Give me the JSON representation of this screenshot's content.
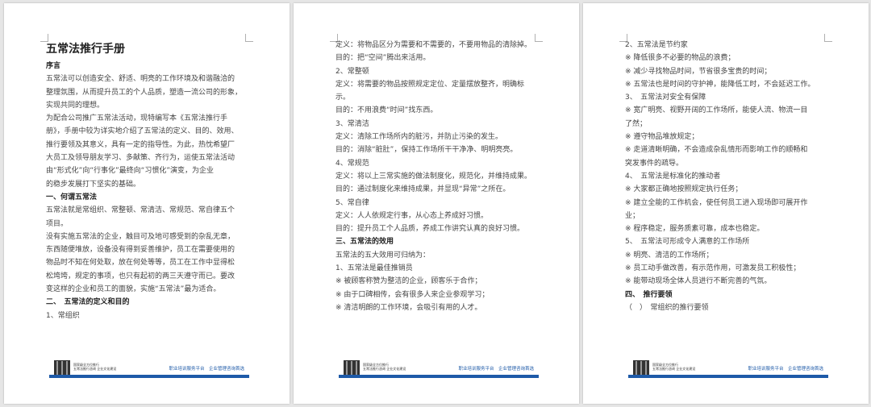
{
  "pages": [
    {
      "title": "五常法推行手册",
      "lines": [
        {
          "t": "序言",
          "s": "h"
        },
        {
          "t": "五常法可以创造安全、舒适、明亮的工作环境及和谐融洽的",
          "s": ""
        },
        {
          "t": "整理氛围，从而提升员工的个人品质，塑造一流公司的形象，",
          "s": ""
        },
        {
          "t": "实现共同的理想。",
          "s": ""
        },
        {
          "t": "为配合公司推广五常法活动，现特编写本《五常法推行手",
          "s": ""
        },
        {
          "t": "册》，手册中较为详实地介绍了五常法的定义、目的、效用、",
          "s": ""
        },
        {
          "t": "推行要领及其意义，具有一定的指导性。为此，热忱希望厂",
          "s": ""
        },
        {
          "t": "大员工及领导朋友学习、多献策、齐行为，运使五常法活动",
          "s": ""
        },
        {
          "t": "由“形式化”向“行事化”最终向“习惯化”演变，为企业",
          "s": ""
        },
        {
          "t": "的稳步发展打下坚实的基础。",
          "s": ""
        },
        {
          "t": "一、何谓五常法",
          "s": "h"
        },
        {
          "t": "五常法就是常组织、常整顿、常清洁、常规范、常自律五个",
          "s": ""
        },
        {
          "t": "项目。",
          "s": ""
        },
        {
          "t": "没有实施五常法的企业，触目可及地可感受到的杂乱无章，",
          "s": ""
        },
        {
          "t": "东西随便堆放，设备没有得到妥善维护，员工在需要使用的",
          "s": ""
        },
        {
          "t": "物品时不知在何处取，放在何处等等，员工在工作中显得松",
          "s": ""
        },
        {
          "t": "松垮垮，规定的事项，也只有起初的两三天遵守而已。要改",
          "s": ""
        },
        {
          "t": "变这样的企业和员工的面貌，实施“五常法”最为适合。",
          "s": ""
        },
        {
          "t": "二、　五常法的定义和目的",
          "s": "h"
        },
        {
          "t": "1、常组织",
          "s": ""
        }
      ]
    },
    {
      "lines": [
        {
          "t": "定义：将物品区分为需要和不需要的，不要用物品的清除掉。",
          "s": ""
        },
        {
          "t": "目的：把“空间”腾出来活用。",
          "s": ""
        },
        {
          "t": "2、常整顿",
          "s": ""
        },
        {
          "t": "定义：将需要的物品按照规定定位、定量摆放整齐，明确标",
          "s": ""
        },
        {
          "t": "示。",
          "s": ""
        },
        {
          "t": "目的：不用浪费“时间”找东西。",
          "s": ""
        },
        {
          "t": "3、常清洁",
          "s": ""
        },
        {
          "t": "定义：清除工作场所内的脏污，并防止污染的发生。",
          "s": ""
        },
        {
          "t": "目的：消除“脏肚”，保持工作场所干干净净、明明亮亮。",
          "s": ""
        },
        {
          "t": "4、常规范",
          "s": ""
        },
        {
          "t": "定义：将以上三常实施的做法制度化，规范化，并维持成果。",
          "s": ""
        },
        {
          "t": "目的：通过制度化来维持成果，并显现“异常”之所在。",
          "s": ""
        },
        {
          "t": "5、常自律",
          "s": ""
        },
        {
          "t": "定义：人人依规定行事，从心态上养成好习惯。",
          "s": ""
        },
        {
          "t": "目的：提升员工个人品质，养成工作讲究认真的良好习惯。",
          "s": ""
        },
        {
          "t": "三、五常法的效用",
          "s": "h"
        },
        {
          "t": "五常法的五大效用可归纳为：",
          "s": ""
        },
        {
          "t": "1、五常法是最佳推销员",
          "s": ""
        },
        {
          "t": "※ 被顾客称赞为整洁的企业，顾客乐于合作；",
          "s": ""
        },
        {
          "t": "※ 由于口碑相传，会有很多人来企业参观学习；",
          "s": ""
        },
        {
          "t": "※ 清洁明朗的工作环境，会吸引有用的人才。",
          "s": ""
        }
      ]
    },
    {
      "lines": [
        {
          "t": "2、五常法是节约家",
          "s": ""
        },
        {
          "t": "※ 降低很多不必要的物品的浪费；",
          "s": ""
        },
        {
          "t": "※ 减少寻找物品时间，节省很多宝贵的时间；",
          "s": ""
        },
        {
          "t": "※ 五常法也是时间的守护神，能降低工时，不会延迟工作。",
          "s": ""
        },
        {
          "t": "3、　五常法对安全有保障",
          "s": ""
        },
        {
          "t": "※ 宽广明亮、视野开阔的工作场所，能使人流、物流一目",
          "s": ""
        },
        {
          "t": "了然；",
          "s": ""
        },
        {
          "t": "※ 遵守物品堆放规定；",
          "s": ""
        },
        {
          "t": "※ 走道清晰明确，不会造成杂乱情形而影响工作的顺畅和",
          "s": ""
        },
        {
          "t": "突发事件的疏导。",
          "s": ""
        },
        {
          "t": "4、　五常法是标准化的推动者",
          "s": ""
        },
        {
          "t": "※ 大家都正确地按照规定执行任务；",
          "s": ""
        },
        {
          "t": "※ 建立全能的工作机会，使任何员工进入现场即可展开作",
          "s": ""
        },
        {
          "t": "业；",
          "s": ""
        },
        {
          "t": "※ 程序稳定，服务质素可靠，成本也稳定。",
          "s": ""
        },
        {
          "t": "5、　五常法可形成令人满意的工作场所",
          "s": ""
        },
        {
          "t": "※ 明亮、清洁的工作场所；",
          "s": ""
        },
        {
          "t": "※ 员工动手做改善，有示范作用，可激发员工积极性；",
          "s": ""
        },
        {
          "t": "※ 能带动现场全体人员进行不断完善的气氛。",
          "s": ""
        },
        {
          "t": "四、　推行要领",
          "s": "h"
        },
        {
          "t": "（　）　常组织的推行要领",
          "s": ""
        }
      ]
    }
  ],
  "footer": {
    "small_line1": "国家级全方位推行",
    "small_line2": "五常法推行咨询 企业文化建设",
    "slogan": "职业培训服务平台　企业管理咨询首选"
  },
  "colors": {
    "accent": "#1e5aa8",
    "page": "#ffffff",
    "background": "#e6e6e6"
  }
}
